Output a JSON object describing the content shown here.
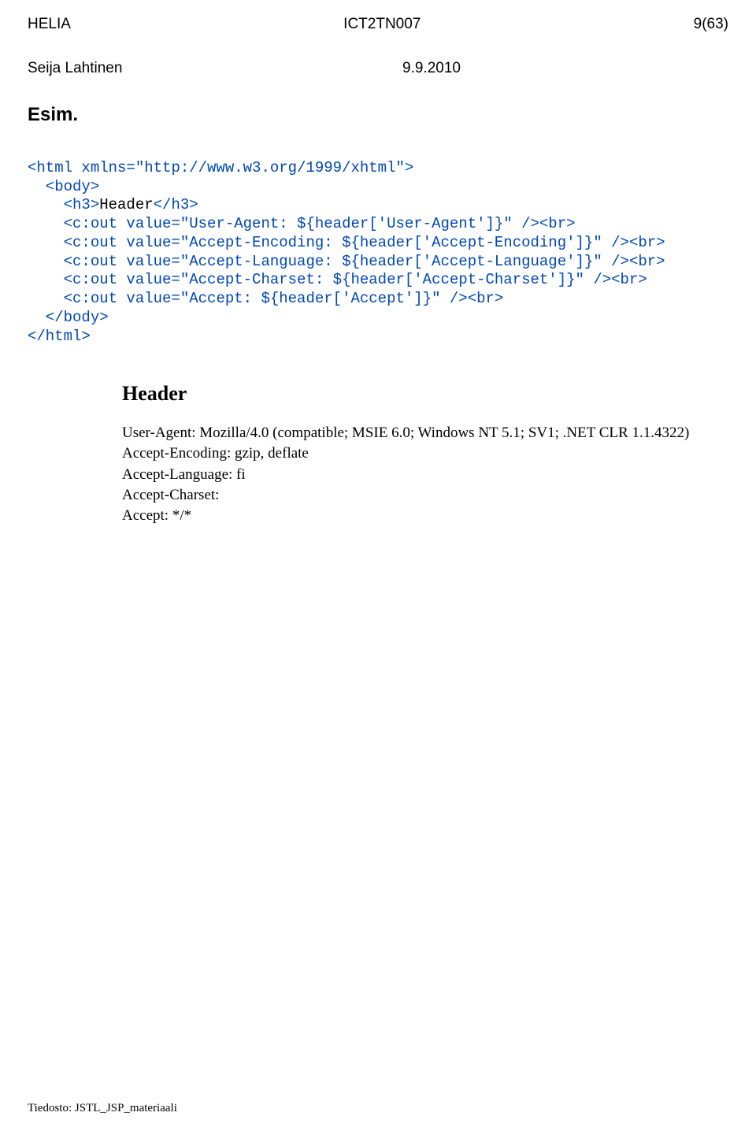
{
  "header": {
    "left": "HELIA",
    "center": "ICT2TN007",
    "right": "9(63)",
    "author": "Seija Lahtinen",
    "date": "9.9.2010"
  },
  "title": "Esim.",
  "code": {
    "l1_open": "<html ",
    "l1_attr": "xmlns=\"http://www.w3.org/1999/xhtml\"",
    "l1_close": ">",
    "l2": "  <body>",
    "l3_a": "    <h3>",
    "l3_b": "Header",
    "l3_c": "</h3>",
    "l4_a": "    <c:out ",
    "l4_b": "value=\"User-Agent: ${header['User-Agent']}\"",
    "l4_c": " /><br>",
    "l5_a": "    <c:out ",
    "l5_b": "value=\"Accept-Encoding: ${header['Accept-Encoding']}\"",
    "l5_c": " /><br>",
    "l6_a": "    <c:out ",
    "l6_b": "value=\"Accept-Language: ${header['Accept-Language']}\"",
    "l6_c": " /><br>",
    "l7_a": "    <c:out ",
    "l7_b": "value=\"Accept-Charset: ${header['Accept-Charset']}\"",
    "l7_c": " /><br>",
    "l8_a": "    <c:out ",
    "l8_b": "value=\"Accept: ${header['Accept']}\"",
    "l8_c": " /><br>",
    "l9": "  </body>",
    "l10": "</html>"
  },
  "output": {
    "heading": "Header",
    "lines": [
      "User-Agent: Mozilla/4.0 (compatible; MSIE 6.0; Windows NT 5.1; SV1; .NET CLR 1.1.4322)",
      "Accept-Encoding: gzip, deflate",
      "Accept-Language: fi",
      "Accept-Charset:",
      "Accept: */*"
    ]
  },
  "footer": "Tiedosto: JSTL_JSP_materiaali"
}
